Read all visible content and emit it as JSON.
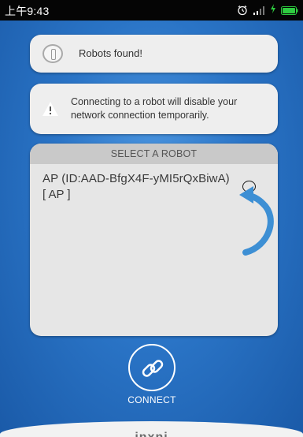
{
  "status_bar": {
    "time": "上午9:43",
    "icons": [
      "alarm-icon",
      "signal-icon",
      "charging-icon",
      "battery-icon"
    ],
    "battery_color": "#2ecc40"
  },
  "found_card": {
    "text": "Robots found!",
    "icon": "info-icon"
  },
  "warning_card": {
    "text": "Connecting to a robot will disable your network connection temporarily.",
    "icon": "warning-icon"
  },
  "robot_list": {
    "header": "SELECT A ROBOT",
    "items": [
      {
        "name": "AP (ID:AAD-BfgX4F-yMI5rQxBiwA)",
        "type": "[ AP ]",
        "selected": false
      }
    ]
  },
  "connect": {
    "label": "CONNECT",
    "icon": "link-icon"
  },
  "footer": {
    "brand": "inxni"
  },
  "colors": {
    "background_primary": "#2a74c6",
    "card": "#eeeeee",
    "hint_arrow": "#3d8fd4"
  }
}
